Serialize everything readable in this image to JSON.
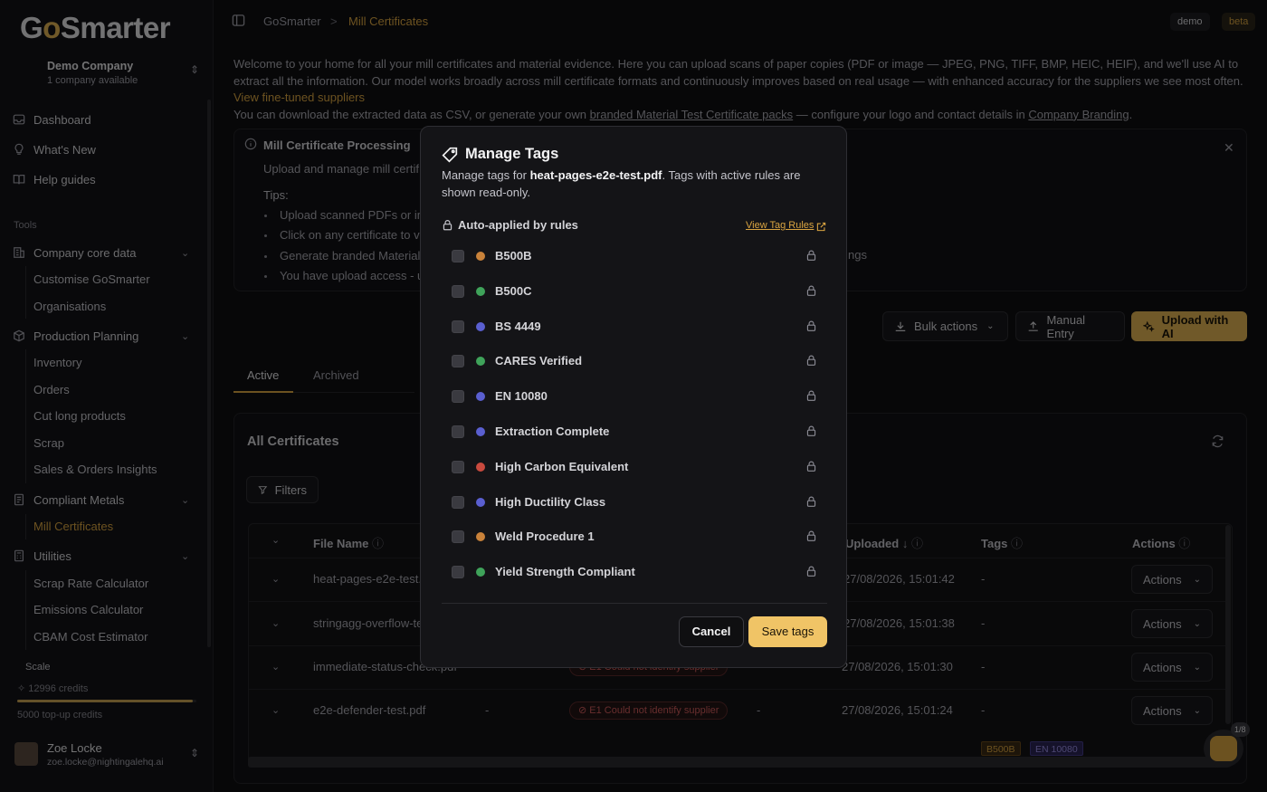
{
  "app": {
    "logo": "GoSmarter",
    "company_name": "Demo Company",
    "company_sub": "1 company available"
  },
  "sidebar": {
    "nav": [
      {
        "label": "Dashboard",
        "icon": "inbox-icon"
      },
      {
        "label": "What's New",
        "icon": "lightbulb-icon"
      },
      {
        "label": "Help guides",
        "icon": "book-icon"
      }
    ],
    "tools_label": "Tools",
    "groups": [
      {
        "label": "Company core data",
        "icon": "building-icon",
        "items": [
          "Customise GoSmarter",
          "Organisations"
        ]
      },
      {
        "label": "Production Planning",
        "icon": "cube-icon",
        "items": [
          "Inventory",
          "Orders",
          "Cut long products",
          "Scrap",
          "Sales & Orders Insights"
        ]
      },
      {
        "label": "Compliant Metals",
        "icon": "document-icon",
        "items": [
          "Mill Certificates"
        ]
      },
      {
        "label": "Utilities",
        "icon": "calculator-icon",
        "items": [
          "Scrap Rate Calculator",
          "Emissions Calculator",
          "CBAM Cost Estimator"
        ]
      }
    ],
    "active_item": "Mill Certificates",
    "scale_label": "Scale",
    "credits": "12996 credits",
    "credit_level": 0.98,
    "topup": "5000 top-up credits",
    "user_name": "Zoe Locke",
    "user_email": "zoe.locke@nightingalehq.ai"
  },
  "topbar": {
    "breadcrumb_home": "GoSmarter",
    "breadcrumb_sep": ">",
    "breadcrumb_current": "Mill Certificates",
    "badge_demo": "demo",
    "badge_beta": "beta"
  },
  "intro": {
    "p1": "Welcome to your home for all your mill certificates and material evidence. Here you can upload scans of paper copies (PDF or image — JPEG, PNG, TIFF, BMP, HEIC, HEIF), and we'll use AI to extract all the information. Our model works broadly across mill certificate formats and continuously improves based on real usage — with enhanced accuracy for the suppliers we see most often.",
    "p1_link": "View fine-tuned suppliers",
    "p2_start": "You can download the extracted data as CSV, or generate your own",
    "p2_link1": "branded Material Test Certificate packs",
    "p2_mid": "— configure your logo and contact details in",
    "p2_link2": "Company Branding",
    "p2_end": "."
  },
  "processing": {
    "title": "Mill Certificate Processing",
    "subtitle": "Upload and manage mill certif",
    "tips_label": "Tips:",
    "tips": [
      "Upload scanned PDFs or im",
      "Click on any certificate to v",
      "Generate branded Material",
      "You have upload access - u"
    ],
    "tip_tail": "ngs"
  },
  "toolbar": {
    "bulk": "Bulk actions",
    "manual": "Manual Entry",
    "upload": "Upload with AI"
  },
  "tabs": {
    "active": "Active",
    "archived": "Archived"
  },
  "certs": {
    "title": "All Certificates",
    "filters": "Filters",
    "columns": {
      "file": "File Name",
      "uploaded": "Uploaded",
      "tags": "Tags",
      "actions": "Actions"
    },
    "rows": [
      {
        "file": "heat-pages-e2e-test.",
        "date": "27/08/2026, 15:01:42",
        "tags": "-",
        "action": "Actions"
      },
      {
        "file": "stringagg-overflow-te",
        "date": "27/08/2026, 15:01:38",
        "tags": "-",
        "action": "Actions"
      },
      {
        "file": "immediate-status-check.pdf",
        "col2": "-",
        "status": "E1 Could not identify supplier",
        "col4": "-",
        "date": "27/08/2026, 15:01:30",
        "tags": "-",
        "action": "Actions"
      },
      {
        "file": "e2e-defender-test.pdf",
        "col2": "-",
        "status": "E1 Could not identify supplier",
        "col4": "-",
        "date": "27/08/2026, 15:01:24",
        "tags": "-",
        "action": "Actions"
      }
    ],
    "tag_chips": [
      "B500B",
      "EN 10080"
    ],
    "assistant_badge": "1/8"
  },
  "modal": {
    "title": "Manage Tags",
    "desc_prefix": "Manage tags for",
    "desc_file": "heat-pages-e2e-test.pdf",
    "desc_suffix": ". Tags with active rules are shown read-only.",
    "auto_label": "Auto-applied by rules",
    "view_rules": "View Tag Rules",
    "tags": [
      {
        "label": "B500B",
        "color": "#c9823a"
      },
      {
        "label": "B500C",
        "color": "#3fa35a"
      },
      {
        "label": "BS 4449",
        "color": "#5a5fd0"
      },
      {
        "label": "CARES Verified",
        "color": "#3fa35a"
      },
      {
        "label": "EN 10080",
        "color": "#5a5fd0"
      },
      {
        "label": "Extraction Complete",
        "color": "#5a5fd0"
      },
      {
        "label": "High Carbon Equivalent",
        "color": "#c94a3e"
      },
      {
        "label": "High Ductility Class",
        "color": "#5a5fd0"
      },
      {
        "label": "Weld Procedure 1",
        "color": "#c9823a"
      },
      {
        "label": "Yield Strength Compliant",
        "color": "#3fa35a"
      }
    ],
    "cancel": "Cancel",
    "save": "Save tags"
  }
}
